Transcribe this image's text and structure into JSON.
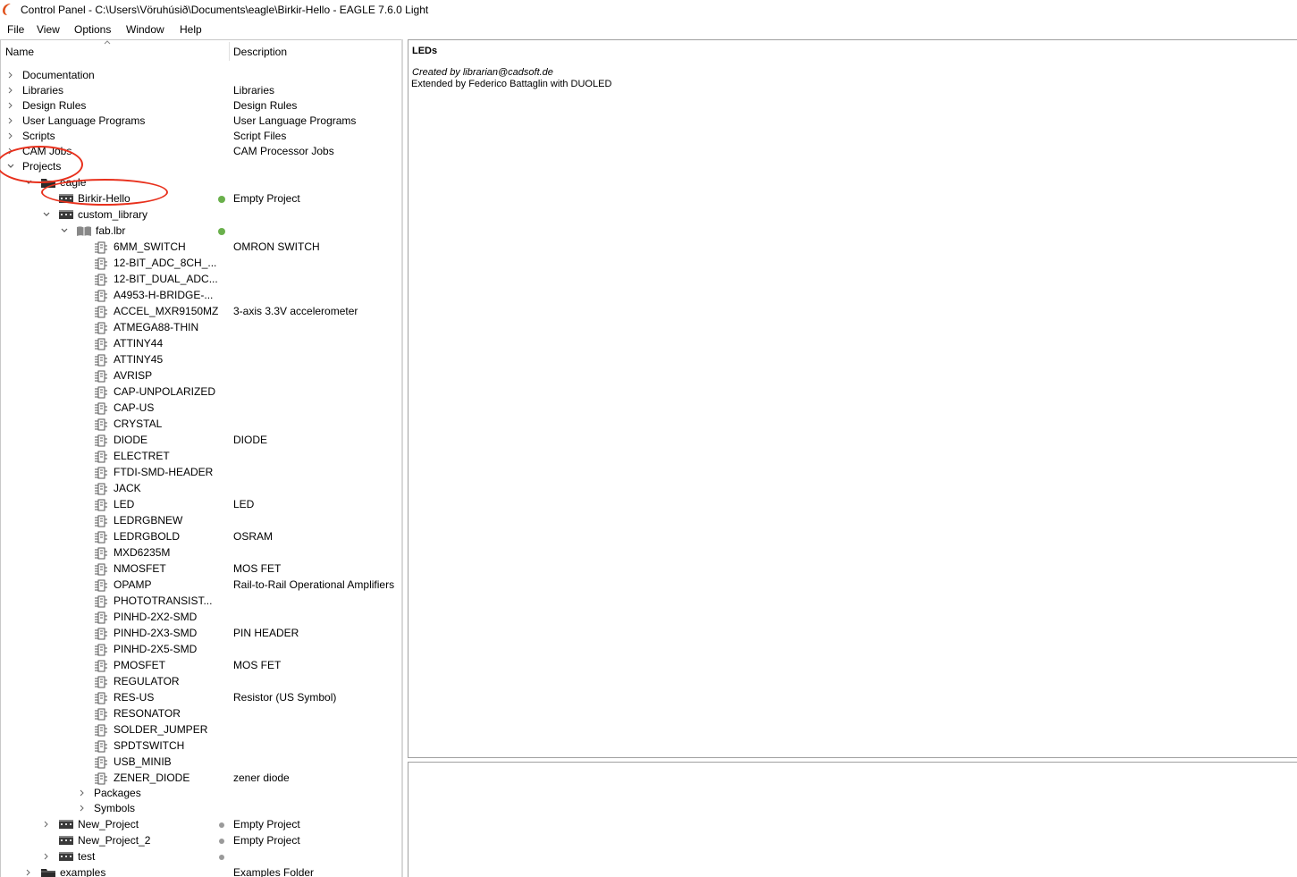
{
  "window": {
    "title": "Control Panel - C:\\Users\\Vöruhúsið\\Documents\\eagle\\Birkir-Hello - EAGLE 7.6.0 Light"
  },
  "menu": [
    "File",
    "View",
    "Options",
    "Window",
    "Help"
  ],
  "tree": {
    "columns": {
      "name": "Name",
      "description": "Description"
    },
    "top_items": [
      {
        "label": "Documentation",
        "desc": ""
      },
      {
        "label": "Libraries",
        "desc": "Libraries"
      },
      {
        "label": "Design Rules",
        "desc": "Design Rules"
      },
      {
        "label": "User Language Programs",
        "desc": "User Language Programs"
      },
      {
        "label": "Scripts",
        "desc": "Script Files"
      },
      {
        "label": "CAM Jobs",
        "desc": "CAM Processor Jobs"
      },
      {
        "label": "Projects",
        "desc": ""
      }
    ],
    "project_folder": {
      "label": "eagle"
    },
    "active_project": {
      "label": "Birkir-Hello",
      "desc": "Empty Project"
    },
    "custom_library": {
      "label": "custom_library"
    },
    "library_file": {
      "label": "fab.lbr"
    },
    "devices": [
      {
        "label": "6MM_SWITCH",
        "desc": "OMRON SWITCH"
      },
      {
        "label": "12-BIT_ADC_8CH_...",
        "desc": ""
      },
      {
        "label": "12-BIT_DUAL_ADC...",
        "desc": ""
      },
      {
        "label": "A4953-H-BRIDGE-...",
        "desc": ""
      },
      {
        "label": "ACCEL_MXR9150MZ",
        "desc": "3-axis 3.3V accelerometer"
      },
      {
        "label": "ATMEGA88-THIN",
        "desc": ""
      },
      {
        "label": "ATTINY44",
        "desc": ""
      },
      {
        "label": "ATTINY45",
        "desc": ""
      },
      {
        "label": "AVRISP",
        "desc": ""
      },
      {
        "label": "CAP-UNPOLARIZED",
        "desc": ""
      },
      {
        "label": "CAP-US",
        "desc": ""
      },
      {
        "label": "CRYSTAL",
        "desc": ""
      },
      {
        "label": "DIODE",
        "desc": "DIODE"
      },
      {
        "label": "ELECTRET",
        "desc": ""
      },
      {
        "label": "FTDI-SMD-HEADER",
        "desc": ""
      },
      {
        "label": "JACK",
        "desc": ""
      },
      {
        "label": "LED",
        "desc": "LED"
      },
      {
        "label": "LEDRGBNEW",
        "desc": ""
      },
      {
        "label": "LEDRGBOLD",
        "desc": "OSRAM"
      },
      {
        "label": "MXD6235M",
        "desc": ""
      },
      {
        "label": "NMOSFET",
        "desc": "MOS FET"
      },
      {
        "label": "OPAMP",
        "desc": "Rail-to-Rail Operational Amplifiers"
      },
      {
        "label": "PHOTOTRANSIST...",
        "desc": ""
      },
      {
        "label": "PINHD-2X2-SMD",
        "desc": ""
      },
      {
        "label": "PINHD-2X3-SMD",
        "desc": "PIN HEADER"
      },
      {
        "label": "PINHD-2X5-SMD",
        "desc": ""
      },
      {
        "label": "PMOSFET",
        "desc": "MOS FET"
      },
      {
        "label": "REGULATOR",
        "desc": ""
      },
      {
        "label": "RES-US",
        "desc": "Resistor (US Symbol)"
      },
      {
        "label": "RESONATOR",
        "desc": ""
      },
      {
        "label": "SOLDER_JUMPER",
        "desc": ""
      },
      {
        "label": "SPDTSWITCH",
        "desc": ""
      },
      {
        "label": "USB_MINIB",
        "desc": ""
      },
      {
        "label": "ZENER_DIODE",
        "desc": "zener diode"
      }
    ],
    "lib_groups": [
      {
        "label": "Packages"
      },
      {
        "label": "Symbols"
      }
    ],
    "other_projects": [
      {
        "label": "New_Project",
        "desc": "Empty Project"
      },
      {
        "label": "New_Project_2",
        "desc": "Empty Project"
      },
      {
        "label": "test",
        "desc": ""
      }
    ],
    "examples": {
      "label": "examples",
      "desc": "Examples Folder"
    }
  },
  "description_panel": {
    "title": "LEDs",
    "created": "Created by librarian@cadsoft.de",
    "extended": "Extended by Federico Battaglin with DUOLED"
  },
  "colors": {
    "annotation": "#e8301c",
    "status_active": "#6ab04c",
    "status_inactive": "#9a9a9a"
  }
}
